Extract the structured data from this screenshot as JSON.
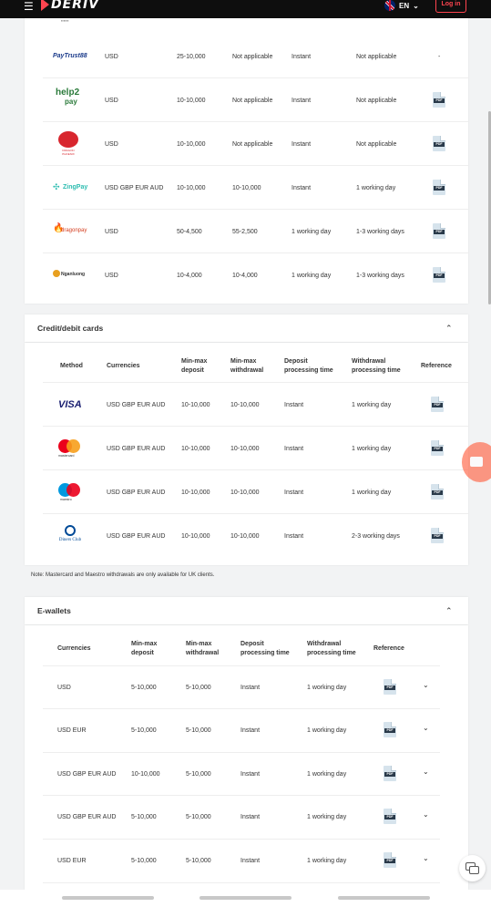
{
  "header": {
    "logo": "DERIV",
    "lang": "EN",
    "login_label": "Log in"
  },
  "bank_rows": [
    {
      "method": "PayTrust88",
      "currencies": "USD",
      "deposit": "25-10,000",
      "withdrawal": "Not applicable",
      "dep_time": "Instant",
      "wd_time": "Not applicable",
      "reference": "-"
    },
    {
      "method": "help2pay",
      "currencies": "USD",
      "deposit": "10-10,000",
      "withdrawal": "Not applicable",
      "dep_time": "Instant",
      "wd_time": "Not applicable",
      "reference": "PDF"
    },
    {
      "method": "Dragon Phoenix",
      "currencies": "USD",
      "deposit": "10-10,000",
      "withdrawal": "Not applicable",
      "dep_time": "Instant",
      "wd_time": "Not applicable",
      "reference": "PDF"
    },
    {
      "method": "ZingPay",
      "currencies": "USD GBP EUR AUD",
      "deposit": "10-10,000",
      "withdrawal": "10-10,000",
      "dep_time": "Instant",
      "wd_time": "1 working day",
      "reference": "PDF"
    },
    {
      "method": "dragonpay",
      "currencies": "USD",
      "deposit": "50-4,500",
      "withdrawal": "55-2,500",
      "dep_time": "1 working day",
      "wd_time": "1-3 working days",
      "reference": "PDF"
    },
    {
      "method": "Nganluong",
      "currencies": "USD",
      "deposit": "10-4,000",
      "withdrawal": "10-4,000",
      "dep_time": "1 working day",
      "wd_time": "1-3 working days",
      "reference": "PDF"
    }
  ],
  "cards_section": {
    "title": "Credit/debit cards",
    "headers": {
      "method": "Method",
      "currencies": "Currencies",
      "deposit": "Min-max deposit",
      "withdrawal": "Min-max withdrawal",
      "dep_time": "Deposit processing time",
      "wd_time": "Withdrawal processing time",
      "reference": "Reference"
    },
    "rows": [
      {
        "method": "VISA",
        "currencies": "USD GBP EUR AUD",
        "deposit": "10-10,000",
        "withdrawal": "10-10,000",
        "dep_time": "Instant",
        "wd_time": "1 working day"
      },
      {
        "method": "mastercard",
        "currencies": "USD GBP EUR AUD",
        "deposit": "10-10,000",
        "withdrawal": "10-10,000",
        "dep_time": "Instant",
        "wd_time": "1 working day"
      },
      {
        "method": "maestro",
        "currencies": "USD GBP EUR AUD",
        "deposit": "10-10,000",
        "withdrawal": "10-10,000",
        "dep_time": "Instant",
        "wd_time": "1 working day"
      },
      {
        "method": "Diners Club",
        "currencies": "USD GBP EUR AUD",
        "deposit": "10-10,000",
        "withdrawal": "10-10,000",
        "dep_time": "Instant",
        "wd_time": "2-3 working days"
      }
    ],
    "note": "Note: Mastercard and Maestro withdrawals are only available for UK clients."
  },
  "ewallets_section": {
    "title": "E-wallets",
    "headers": {
      "currencies": "Currencies",
      "deposit": "Min-max deposit",
      "withdrawal": "Min-max withdrawal",
      "dep_time": "Deposit processing time",
      "wd_time": "Withdrawal processing time",
      "reference": "Reference"
    },
    "rows": [
      {
        "currencies": "USD",
        "deposit": "5-10,000",
        "withdrawal": "5-10,000",
        "dep_time": "Instant",
        "wd_time": "1 working day"
      },
      {
        "currencies": "USD EUR",
        "deposit": "5-10,000",
        "withdrawal": "5-10,000",
        "dep_time": "Instant",
        "wd_time": "1 working day"
      },
      {
        "currencies": "USD GBP EUR AUD",
        "deposit": "10-10,000",
        "withdrawal": "5-10,000",
        "dep_time": "Instant",
        "wd_time": "1 working day"
      },
      {
        "currencies": "USD GBP EUR AUD",
        "deposit": "5-10,000",
        "withdrawal": "5-10,000",
        "dep_time": "Instant",
        "wd_time": "1 working day"
      },
      {
        "currencies": "USD EUR",
        "deposit": "5-10,000",
        "withdrawal": "5-10,000",
        "dep_time": "Instant",
        "wd_time": "1 working day"
      }
    ]
  },
  "pdf_label": "PDF",
  "colors": {
    "brand": "#ff444f",
    "header_bg": "#0e0e0e",
    "page_bg": "#f2f3f4"
  }
}
